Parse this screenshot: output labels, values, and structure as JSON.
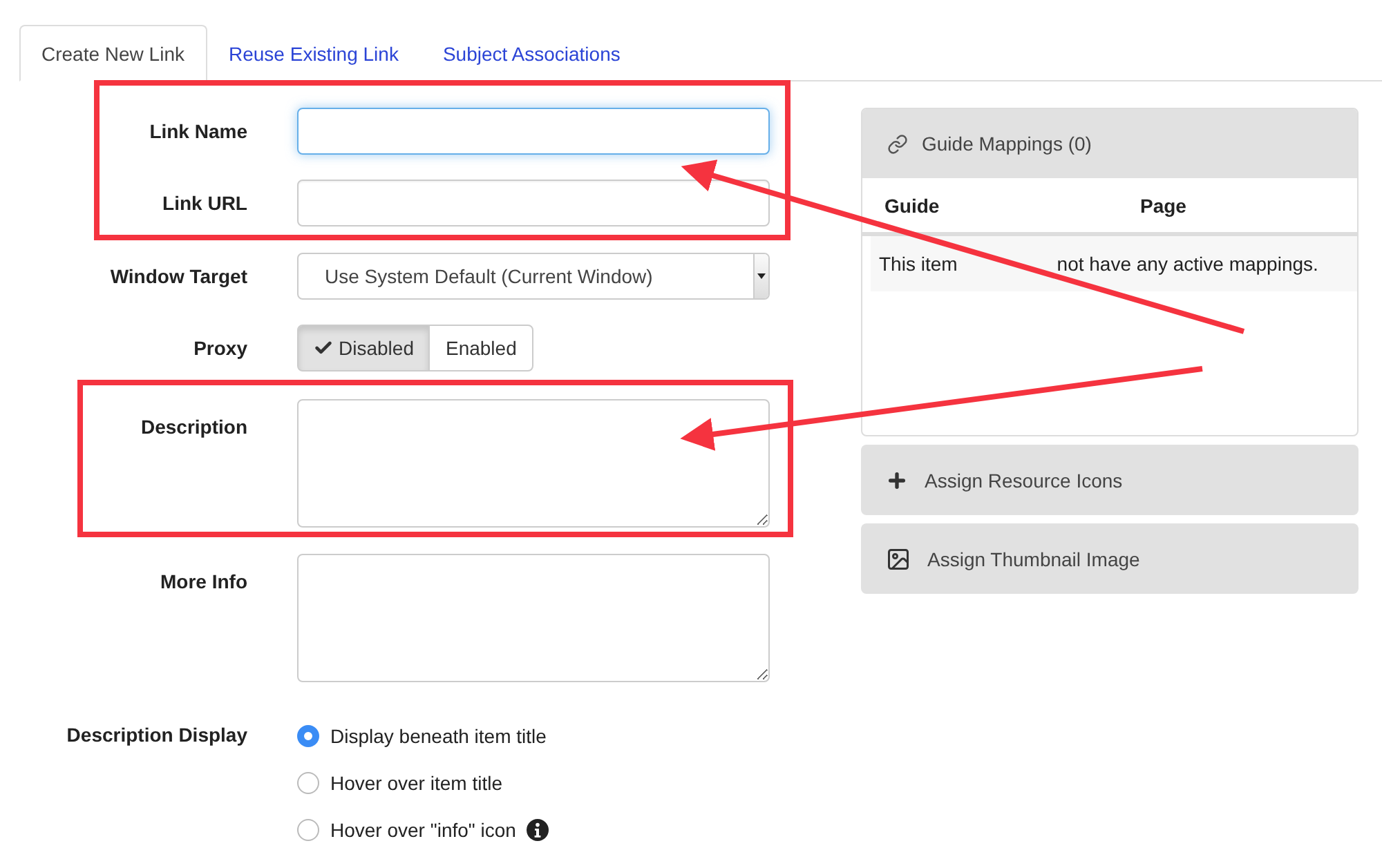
{
  "tabs": [
    {
      "label": "Create New Link",
      "selected": true
    },
    {
      "label": "Reuse Existing Link",
      "selected": false
    },
    {
      "label": "Subject Associations",
      "selected": false
    }
  ],
  "form": {
    "fields": [
      {
        "kind": "text",
        "label": "Link Name",
        "focused": true
      },
      {
        "kind": "text",
        "label": "Link URL",
        "focused": false
      },
      {
        "kind": "select",
        "label": "Window Target",
        "value": "Use System Default (Current Window)"
      },
      {
        "kind": "toggle",
        "label": "Proxy",
        "options": [
          {
            "label": "Disabled",
            "selected": true
          },
          {
            "label": "Enabled",
            "selected": false
          }
        ]
      },
      {
        "kind": "textarea",
        "label": "Description"
      },
      {
        "kind": "textarea",
        "label": "More Info"
      },
      {
        "kind": "radio",
        "label": "Description Display",
        "options": [
          {
            "label": "Display beneath item title",
            "selected": true,
            "info_icon": false
          },
          {
            "label": "Hover over item title",
            "selected": false,
            "info_icon": false
          },
          {
            "label": "Hover over \"info\" icon",
            "selected": false,
            "info_icon": true
          }
        ]
      }
    ]
  },
  "guide_mappings": {
    "title": "Guide Mappings (0)",
    "columns": [
      "Guide",
      "Page"
    ],
    "empty_message_parts": [
      "This item",
      "not have any active mappings."
    ]
  },
  "panels": [
    {
      "kind": "plus",
      "label": "Assign Resource Icons"
    },
    {
      "kind": "image",
      "label": "Assign Thumbnail Image"
    }
  ]
}
